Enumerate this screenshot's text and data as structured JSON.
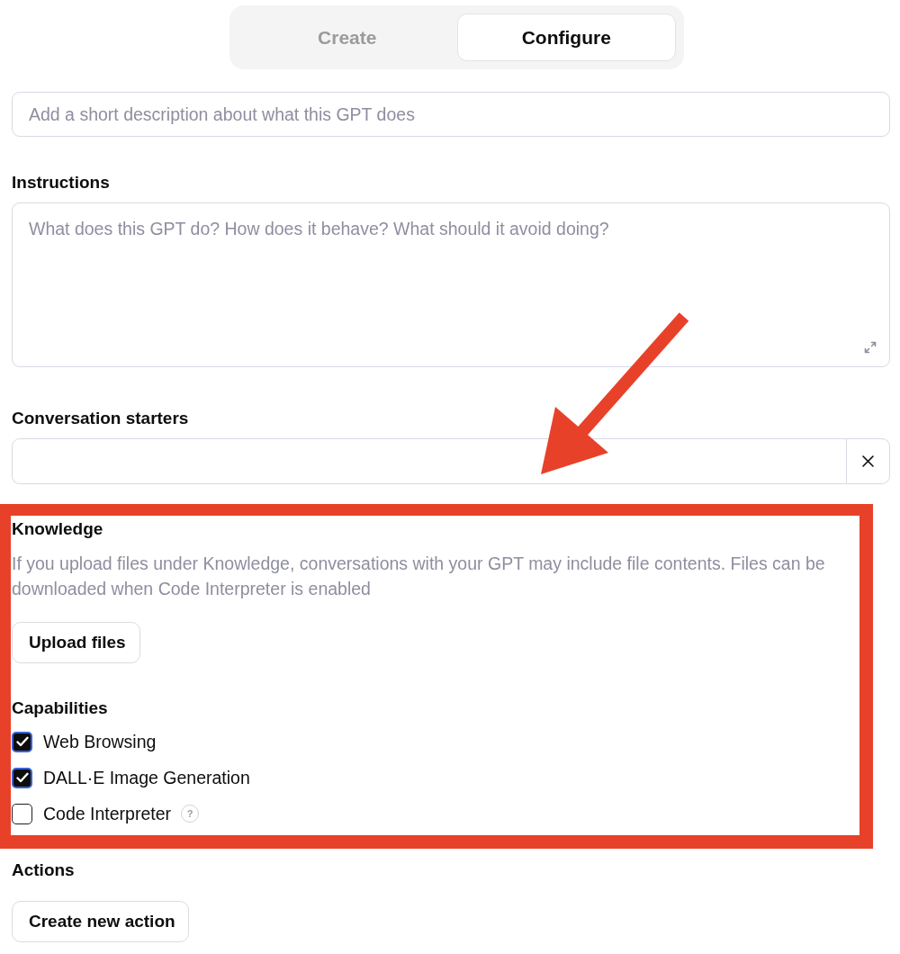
{
  "tabs": [
    {
      "label": "Create",
      "selected": false
    },
    {
      "label": "Configure",
      "selected": true
    }
  ],
  "description_field": {
    "placeholder": "Add a short description about what this GPT does"
  },
  "instructions": {
    "label": "Instructions",
    "placeholder": "What does this GPT do? How does it behave? What should it avoid doing?"
  },
  "conversation_starters": {
    "label": "Conversation starters"
  },
  "knowledge": {
    "title": "Knowledge",
    "description": "If you upload files under Knowledge, conversations with your GPT may include file contents. Files can be downloaded when Code Interpreter is enabled",
    "upload_button": "Upload files"
  },
  "capabilities": {
    "title": "Capabilities",
    "items": [
      {
        "label": "Web Browsing",
        "checked": true
      },
      {
        "label": "DALL·E Image Generation",
        "checked": true
      },
      {
        "label": "Code Interpreter",
        "checked": false,
        "help": "?"
      }
    ]
  },
  "actions": {
    "title": "Actions",
    "button": "Create new action"
  }
}
